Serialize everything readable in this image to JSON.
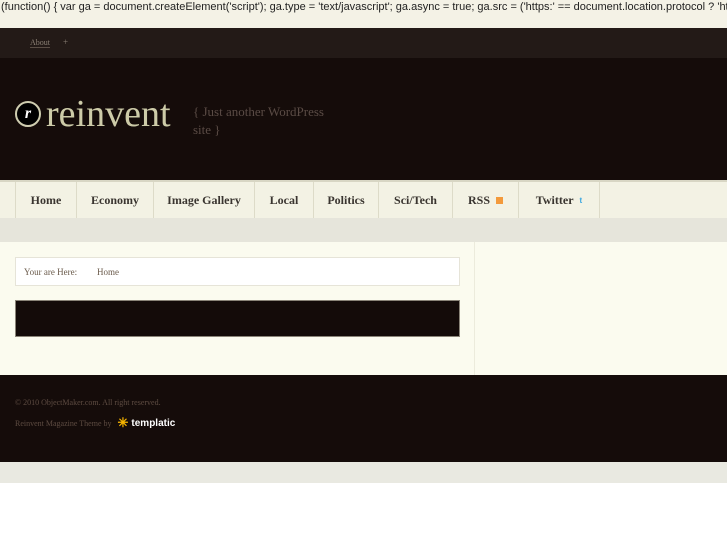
{
  "script_text": "(function() { var ga = document.createElement('script'); ga.type = 'text/javascript'; ga.async = true; ga.src = ('https:' == document.location.protocol ? 'https://ssl' : 'http://www') + '.google-analytics.com/ga.js'; var s = document.getElementsByTagName('script')[0]; s.parentNode.insertBefore(ga, s); })();",
  "topbar": {
    "about": "About",
    "plus": "+"
  },
  "header": {
    "logo_letter": "r",
    "site_name": "reinvent",
    "tagline": "{ Just another WordPress site }"
  },
  "nav": [
    {
      "label": "Home"
    },
    {
      "label": "Economy"
    },
    {
      "label": "Image Gallery"
    },
    {
      "label": "Local"
    },
    {
      "label": "Politics"
    },
    {
      "label": "Sci/Tech"
    },
    {
      "label": "RSS"
    },
    {
      "label": "Twitter",
      "icon": "t"
    }
  ],
  "breadcrumb": {
    "label": "Your are Here:",
    "current": "Home"
  },
  "footer": {
    "copyright": "© 2010 ObjectMaker.com. All right reserved.",
    "theme": "Reinvent Magazine Theme by",
    "brand": "templatic"
  }
}
